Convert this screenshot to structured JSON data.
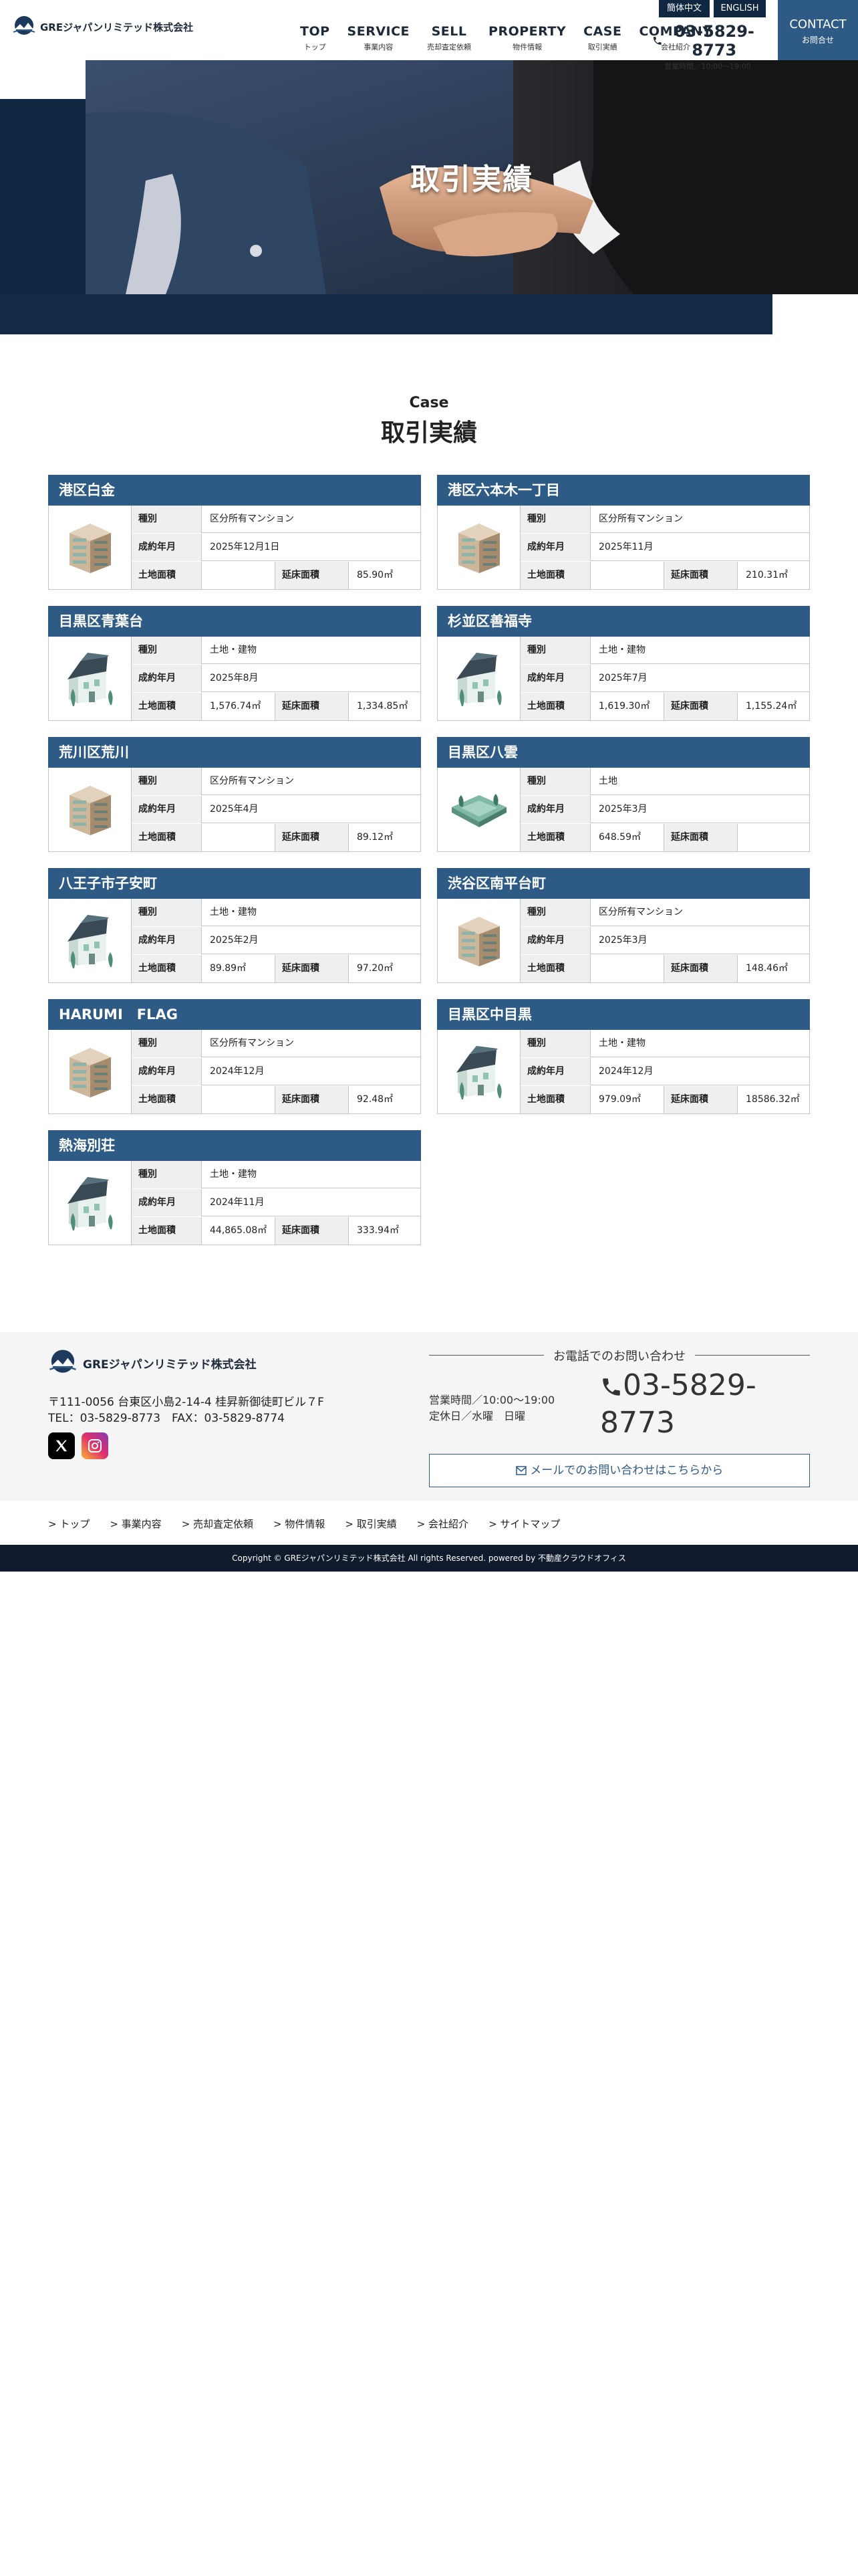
{
  "header": {
    "logo_text": "GREジャパンリミテッド株式会社",
    "nav": [
      {
        "en": "TOP",
        "jp": "トップ"
      },
      {
        "en": "SERVICE",
        "jp": "事業内容"
      },
      {
        "en": "SELL",
        "jp": "売却査定依頼"
      },
      {
        "en": "PROPERTY",
        "jp": "物件情報"
      },
      {
        "en": "CASE",
        "jp": "取引実績"
      },
      {
        "en": "COMPANY",
        "jp": "会社紹介"
      }
    ],
    "lang_cn": "簡体中文",
    "lang_en": "ENGLISH",
    "phone": "03-5829-8773",
    "hours": "営業時間／10:00〜19:00",
    "contact_en": "CONTACT",
    "contact_jp": "お問合せ"
  },
  "hero": {
    "title": "取引実績"
  },
  "section": {
    "en": "Case",
    "jp": "取引実績"
  },
  "labels": {
    "type": "種別",
    "date": "成約年月",
    "land": "土地面積",
    "floor": "延床面積"
  },
  "cases": [
    {
      "name": "港区白金",
      "type": "区分所有マンション",
      "date": "2025年12月1日",
      "land": "",
      "floor": "85.90㎡",
      "icon": "condo-building-icon"
    },
    {
      "name": "港区六本木一丁目",
      "type": "区分所有マンション",
      "date": "2025年11月",
      "land": "",
      "floor": "210.31㎡",
      "icon": "condo-building-icon"
    },
    {
      "name": "目黒区青葉台",
      "type": "土地・建物",
      "date": "2025年8月",
      "land": "1,576.74㎡",
      "floor": "1,334.85㎡",
      "icon": "house-icon"
    },
    {
      "name": "杉並区善福寺",
      "type": "土地・建物",
      "date": "2025年7月",
      "land": "1,619.30㎡",
      "floor": "1,155.24㎡",
      "icon": "house-icon"
    },
    {
      "name": "荒川区荒川",
      "type": "区分所有マンション",
      "date": "2025年4月",
      "land": "",
      "floor": "89.12㎡",
      "icon": "condo-building-icon"
    },
    {
      "name": "目黒区八雲",
      "type": "土地",
      "date": "2025年3月",
      "land": "648.59㎡",
      "floor": "",
      "icon": "land-plot-icon"
    },
    {
      "name": "八王子市子安町",
      "type": "土地・建物",
      "date": "2025年2月",
      "land": "89.89㎡",
      "floor": "97.20㎡",
      "icon": "house-icon"
    },
    {
      "name": "渋谷区南平台町",
      "type": "区分所有マンション",
      "date": "2025年3月",
      "land": "",
      "floor": "148.46㎡",
      "icon": "condo-building-icon"
    },
    {
      "name": "HARUMI　FLAG",
      "type": "区分所有マンション",
      "date": "2024年12月",
      "land": "",
      "floor": "92.48㎡",
      "icon": "condo-building-icon"
    },
    {
      "name": "目黒区中目黒",
      "type": "土地・建物",
      "date": "2024年12月",
      "land": "979.09㎡",
      "floor": "18586.32㎡",
      "icon": "house-icon"
    },
    {
      "name": "熱海別荘",
      "type": "土地・建物",
      "date": "2024年11月",
      "land": "44,865.08㎡",
      "floor": "333.94㎡",
      "icon": "house-icon"
    }
  ],
  "footer": {
    "logo_text": "GREジャパンリミテッド株式会社",
    "address": "〒111-0056 台東区小島2-14-4 桂昇新御徒町ビル７F",
    "tel_fax": "TEL：03-5829-8773　FAX：03-5829-8774",
    "phone_label": "お電話でのお問い合わせ",
    "hours_line1": "営業時間／10:00〜19:00",
    "hours_line2": "定休日／水曜　日曜",
    "phone": "03-5829-8773",
    "mail_button": "メールでのお問い合わせはこちらから",
    "links": [
      "> トップ",
      "> 事業内容",
      "> 売却査定依頼",
      "> 物件情報",
      "> 取引実績",
      "> 会社紹介",
      "> サイトマップ"
    ],
    "copyright": "Copyright © GREジャパンリミテッド株式会社 All rights Reserved. powered by 不動産クラウドオフィス"
  }
}
